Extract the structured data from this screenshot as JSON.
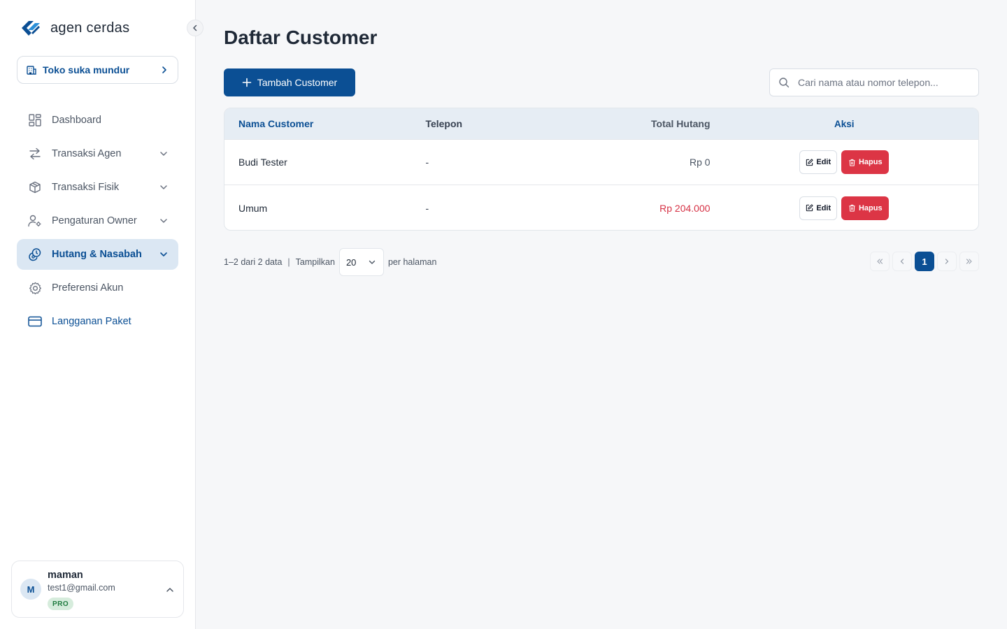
{
  "brand": {
    "name": "agen cerdas"
  },
  "store": {
    "label": "Toko suka mundur"
  },
  "sidebar": {
    "items": [
      {
        "label": "Dashboard",
        "icon": "grid-icon"
      },
      {
        "label": "Transaksi Agen",
        "icon": "arrows-swap-icon"
      },
      {
        "label": "Transaksi Fisik",
        "icon": "box-icon"
      },
      {
        "label": "Pengaturan Owner",
        "icon": "user-gear-icon"
      },
      {
        "label": "Hutang & Nasabah",
        "icon": "coins-icon"
      },
      {
        "label": "Preferensi Akun",
        "icon": "gear-icon"
      },
      {
        "label": "Langganan Paket",
        "icon": "credit-card-icon"
      }
    ]
  },
  "user": {
    "initial": "M",
    "name": "maman",
    "email": "test1@gmail.com",
    "plan": "PRO"
  },
  "page": {
    "title": "Daftar Customer"
  },
  "toolbar": {
    "add_label": "Tambah Customer",
    "search_placeholder": "Cari nama atau nomor telepon..."
  },
  "table": {
    "headers": {
      "name": "Nama Customer",
      "phone": "Telepon",
      "total": "Total Hutang",
      "action": "Aksi"
    },
    "rows": [
      {
        "name": "Budi Tester",
        "phone": "-",
        "total": "Rp 0",
        "edit": "Edit",
        "delete": "Hapus"
      },
      {
        "name": "Umum",
        "phone": "-",
        "total": "Rp 204.000",
        "edit": "Edit",
        "delete": "Hapus"
      }
    ]
  },
  "pagination": {
    "summary": "1–2 dari 2 data",
    "show_label": "Tampilkan",
    "per_page": "20",
    "per_page_suffix": "per halaman",
    "current_page": "1"
  },
  "colors": {
    "primary": "#0b4f94",
    "danger": "#dc3545",
    "active_bg": "#dbe7f3"
  }
}
